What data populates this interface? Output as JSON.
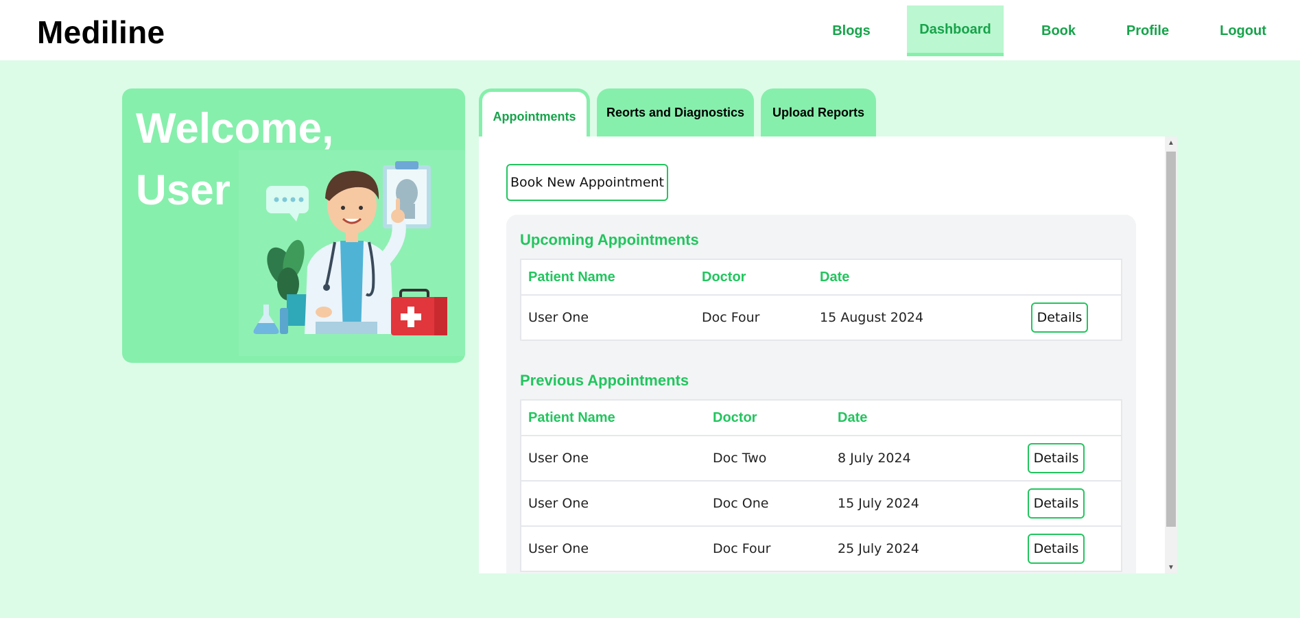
{
  "brand": "Mediline",
  "nav": {
    "items": [
      {
        "label": "Blogs",
        "active": false
      },
      {
        "label": "Dashboard",
        "active": true
      },
      {
        "label": "Book",
        "active": false
      },
      {
        "label": "Profile",
        "active": false
      },
      {
        "label": "Logout",
        "active": false
      }
    ]
  },
  "welcome": {
    "title": "Welcome, User",
    "illustration_icon": "doctor-illustration"
  },
  "tabs": [
    {
      "label": "Appointments",
      "active": true
    },
    {
      "label": "Reorts and Diagnostics",
      "active": false
    },
    {
      "label": "Upload Reports",
      "active": false
    }
  ],
  "panel": {
    "book_button": "Book New Appointment",
    "upcoming": {
      "title": "Upcoming Appointments",
      "columns": [
        "Patient Name",
        "Doctor",
        "Date"
      ],
      "rows": [
        {
          "patient": "User One",
          "doctor": "Doc Four",
          "date": "15 August 2024",
          "action": "Details"
        }
      ]
    },
    "previous": {
      "title": "Previous Appointments",
      "columns": [
        "Patient Name",
        "Doctor",
        "Date"
      ],
      "rows": [
        {
          "patient": "User One",
          "doctor": "Doc Two",
          "date": "8 July 2024",
          "action": "Details"
        },
        {
          "patient": "User One",
          "doctor": "Doc One",
          "date": "15 July 2024",
          "action": "Details"
        },
        {
          "patient": "User One",
          "doctor": "Doc Four",
          "date": "25 July 2024",
          "action": "Details"
        }
      ]
    }
  },
  "colors": {
    "accent": "#22c55e",
    "page_bg": "#dcfce7",
    "tab_bg": "#86efac"
  }
}
